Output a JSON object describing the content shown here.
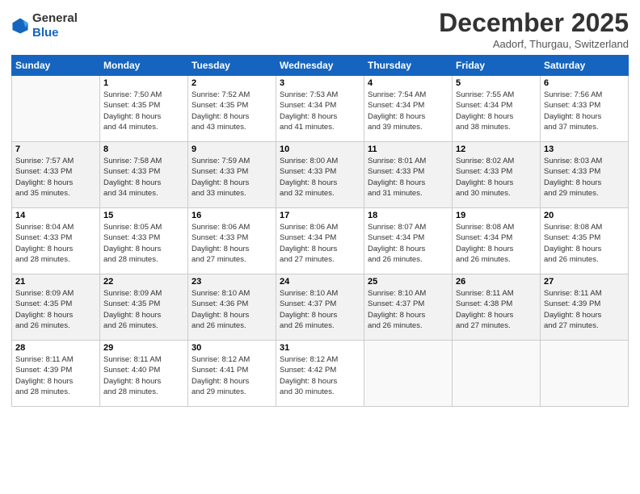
{
  "header": {
    "logo_line1": "General",
    "logo_line2": "Blue",
    "month_title": "December 2025",
    "subtitle": "Aadorf, Thurgau, Switzerland"
  },
  "weekdays": [
    "Sunday",
    "Monday",
    "Tuesday",
    "Wednesday",
    "Thursday",
    "Friday",
    "Saturday"
  ],
  "weeks": [
    [
      {
        "day": "",
        "info": ""
      },
      {
        "day": "1",
        "info": "Sunrise: 7:50 AM\nSunset: 4:35 PM\nDaylight: 8 hours\nand 44 minutes."
      },
      {
        "day": "2",
        "info": "Sunrise: 7:52 AM\nSunset: 4:35 PM\nDaylight: 8 hours\nand 43 minutes."
      },
      {
        "day": "3",
        "info": "Sunrise: 7:53 AM\nSunset: 4:34 PM\nDaylight: 8 hours\nand 41 minutes."
      },
      {
        "day": "4",
        "info": "Sunrise: 7:54 AM\nSunset: 4:34 PM\nDaylight: 8 hours\nand 39 minutes."
      },
      {
        "day": "5",
        "info": "Sunrise: 7:55 AM\nSunset: 4:34 PM\nDaylight: 8 hours\nand 38 minutes."
      },
      {
        "day": "6",
        "info": "Sunrise: 7:56 AM\nSunset: 4:33 PM\nDaylight: 8 hours\nand 37 minutes."
      }
    ],
    [
      {
        "day": "7",
        "info": "Sunrise: 7:57 AM\nSunset: 4:33 PM\nDaylight: 8 hours\nand 35 minutes."
      },
      {
        "day": "8",
        "info": "Sunrise: 7:58 AM\nSunset: 4:33 PM\nDaylight: 8 hours\nand 34 minutes."
      },
      {
        "day": "9",
        "info": "Sunrise: 7:59 AM\nSunset: 4:33 PM\nDaylight: 8 hours\nand 33 minutes."
      },
      {
        "day": "10",
        "info": "Sunrise: 8:00 AM\nSunset: 4:33 PM\nDaylight: 8 hours\nand 32 minutes."
      },
      {
        "day": "11",
        "info": "Sunrise: 8:01 AM\nSunset: 4:33 PM\nDaylight: 8 hours\nand 31 minutes."
      },
      {
        "day": "12",
        "info": "Sunrise: 8:02 AM\nSunset: 4:33 PM\nDaylight: 8 hours\nand 30 minutes."
      },
      {
        "day": "13",
        "info": "Sunrise: 8:03 AM\nSunset: 4:33 PM\nDaylight: 8 hours\nand 29 minutes."
      }
    ],
    [
      {
        "day": "14",
        "info": "Sunrise: 8:04 AM\nSunset: 4:33 PM\nDaylight: 8 hours\nand 28 minutes."
      },
      {
        "day": "15",
        "info": "Sunrise: 8:05 AM\nSunset: 4:33 PM\nDaylight: 8 hours\nand 28 minutes."
      },
      {
        "day": "16",
        "info": "Sunrise: 8:06 AM\nSunset: 4:33 PM\nDaylight: 8 hours\nand 27 minutes."
      },
      {
        "day": "17",
        "info": "Sunrise: 8:06 AM\nSunset: 4:34 PM\nDaylight: 8 hours\nand 27 minutes."
      },
      {
        "day": "18",
        "info": "Sunrise: 8:07 AM\nSunset: 4:34 PM\nDaylight: 8 hours\nand 26 minutes."
      },
      {
        "day": "19",
        "info": "Sunrise: 8:08 AM\nSunset: 4:34 PM\nDaylight: 8 hours\nand 26 minutes."
      },
      {
        "day": "20",
        "info": "Sunrise: 8:08 AM\nSunset: 4:35 PM\nDaylight: 8 hours\nand 26 minutes."
      }
    ],
    [
      {
        "day": "21",
        "info": "Sunrise: 8:09 AM\nSunset: 4:35 PM\nDaylight: 8 hours\nand 26 minutes."
      },
      {
        "day": "22",
        "info": "Sunrise: 8:09 AM\nSunset: 4:35 PM\nDaylight: 8 hours\nand 26 minutes."
      },
      {
        "day": "23",
        "info": "Sunrise: 8:10 AM\nSunset: 4:36 PM\nDaylight: 8 hours\nand 26 minutes."
      },
      {
        "day": "24",
        "info": "Sunrise: 8:10 AM\nSunset: 4:37 PM\nDaylight: 8 hours\nand 26 minutes."
      },
      {
        "day": "25",
        "info": "Sunrise: 8:10 AM\nSunset: 4:37 PM\nDaylight: 8 hours\nand 26 minutes."
      },
      {
        "day": "26",
        "info": "Sunrise: 8:11 AM\nSunset: 4:38 PM\nDaylight: 8 hours\nand 27 minutes."
      },
      {
        "day": "27",
        "info": "Sunrise: 8:11 AM\nSunset: 4:39 PM\nDaylight: 8 hours\nand 27 minutes."
      }
    ],
    [
      {
        "day": "28",
        "info": "Sunrise: 8:11 AM\nSunset: 4:39 PM\nDaylight: 8 hours\nand 28 minutes."
      },
      {
        "day": "29",
        "info": "Sunrise: 8:11 AM\nSunset: 4:40 PM\nDaylight: 8 hours\nand 28 minutes."
      },
      {
        "day": "30",
        "info": "Sunrise: 8:12 AM\nSunset: 4:41 PM\nDaylight: 8 hours\nand 29 minutes."
      },
      {
        "day": "31",
        "info": "Sunrise: 8:12 AM\nSunset: 4:42 PM\nDaylight: 8 hours\nand 30 minutes."
      },
      {
        "day": "",
        "info": ""
      },
      {
        "day": "",
        "info": ""
      },
      {
        "day": "",
        "info": ""
      }
    ]
  ]
}
